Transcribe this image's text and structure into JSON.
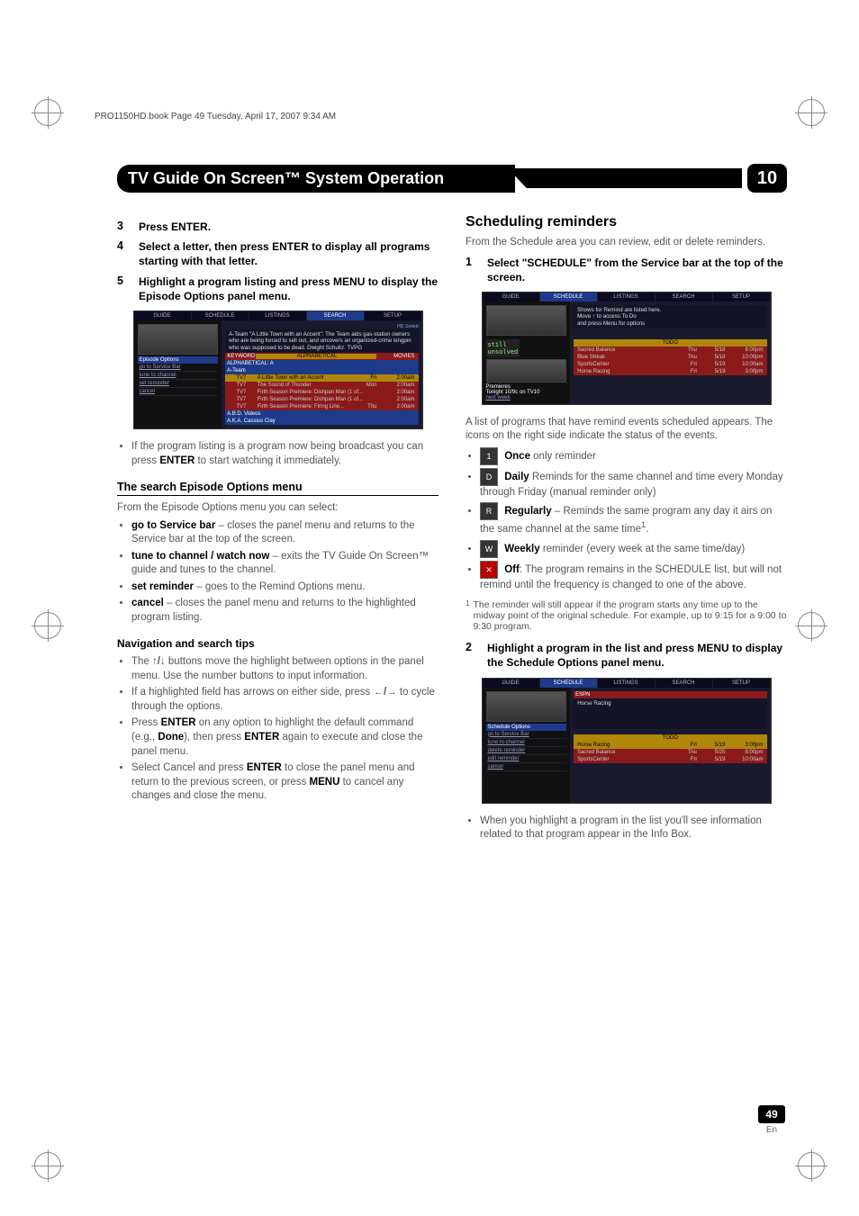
{
  "header_info": "PRO1150HD.book  Page 49  Tuesday, April 17, 2007  9:34 AM",
  "title": "TV Guide On Screen™ System Operation",
  "chapter": "10",
  "left": {
    "step3": {
      "num": "3",
      "text": "Press ENTER."
    },
    "step4": {
      "num": "4",
      "text": "Select a letter, then press ENTER to display all programs starting with that letter."
    },
    "step5": {
      "num": "5",
      "text": "Highlight a program listing and press MENU to display the Episode Options panel menu."
    },
    "para_after_ss": "If the program listing is a program now being broadcast you can press ",
    "para_after_ss_bold": "ENTER",
    "para_after_ss_end": " to start watching it immediately.",
    "h3_search": "The search Episode Options menu",
    "search_intro": "From the Episode Options menu you can select:",
    "search_items": [
      {
        "bold": "go to Service bar",
        "rest": " – closes the panel menu and returns to the Service bar at the top of the screen."
      },
      {
        "bold": "tune to channel / watch now",
        "rest": " – exits the TV Guide On Screen™ guide and tunes to the channel."
      },
      {
        "bold": "set reminder",
        "rest": " – goes to the Remind Options menu."
      },
      {
        "bold": "cancel",
        "rest": " – closes the panel menu and returns to the highlighted program listing."
      }
    ],
    "h4_nav": "Navigation and search tips",
    "nav_items": [
      "The ↑/↓ buttons move the highlight between options in the panel menu. Use the number buttons to input information.",
      "If a highlighted field has arrows on either side, press ←/→ to cycle through the options.",
      "Press ENTER on any option to highlight the default command (e.g., Done), then press ENTER again to execute and close the panel menu.",
      "Select Cancel and press ENTER to close the panel menu and return to the previous screen, or press MENU to cancel any changes and close the menu."
    ],
    "nav_item1_a": "The ",
    "nav_item1_b": " buttons move the highlight between options in the panel menu. Use the number buttons to input information.",
    "nav_item2_a": "If a highlighted field has arrows on either side, press ",
    "nav_item2_b": " to cycle through the options.",
    "nav_item3_a": "Press ",
    "nav_item3_b": " on any option to highlight the default command (e.g., ",
    "nav_item3_c": "), then press ",
    "nav_item3_d": " again to execute and close the panel menu.",
    "nav_item4_a": "Select Cancel and press ",
    "nav_item4_b": " to close the panel menu and return to the previous screen, or press ",
    "nav_item4_c": " to cancel any changes and close the menu.",
    "enter": "ENTER",
    "done": "Done",
    "menu": "MENU",
    "updown": "↑/↓",
    "leftright": "←/→"
  },
  "right": {
    "h2": "Scheduling reminders",
    "intro": "From the Schedule area you can review, edit or delete reminders.",
    "step1": {
      "num": "1",
      "text": "Select \"SCHEDULE\" from the Service bar at the top of the screen."
    },
    "after_ss1": "A list of programs that have remind events scheduled appears. The icons on the right side indicate the status of the events.",
    "icons": [
      {
        "bold": "Once",
        "rest": " only reminder"
      },
      {
        "bold": "Daily",
        "rest": " Reminds for the same channel and time every Monday through Friday (manual reminder only)"
      },
      {
        "bold": "Regularly",
        "rest": " – Reminds the same program any day it airs on the same channel at the same time"
      },
      {
        "bold": "Weekly",
        "rest": " reminder (every week at the same time/day)"
      },
      {
        "bold": "Off",
        "rest": ": The program remains in the SCHEDULE list, but will not remind until the frequency is changed to one of the above."
      }
    ],
    "footnote_num": "1",
    "footnote": "The reminder will still appear if the program starts any time up to the midway point of the original schedule. For example, up to 9:15 for a 9:00 to 9:30 program.",
    "step2": {
      "num": "2",
      "text": "Highlight a program in the list and press MENU to display the Schedule Options panel menu."
    },
    "after_ss2": "When you highlight a program in the list you'll see information related to that program appear in the Info Box."
  },
  "page_num": "49",
  "page_lang": "En",
  "ss1": {
    "tabs": [
      "GUIDE",
      "SCHEDULE",
      "LISTINGS",
      "SEARCH",
      "SETUP"
    ],
    "active_tab": 3,
    "sort_label": "HD Sorted",
    "info": "A-Team \"A Little Town with an Accent\": The Team aids gas-station owners who are being forced to sell out, and uncovers an organized-crime kingpin who was supposed to be dead. Dwight Schultz. TVPG",
    "left_title": "Episode Options",
    "left_items": [
      "go to Service Bar",
      "tune to channel",
      "set reminder",
      "cancel"
    ],
    "cat_row": [
      "KEYWORD",
      "ALPHABETICAL",
      "MOVIES"
    ],
    "group": "ALPHABETICAL: A",
    "series": "A-Team",
    "rows": [
      {
        "ch": "TV7",
        "title": "A Little Town with an Accent",
        "day": "Fri",
        "time": "2:00am"
      },
      {
        "ch": "TV7",
        "title": "The Sound of Thunder",
        "day": "Mon",
        "time": "2:00am"
      },
      {
        "ch": "TV7",
        "title": "Firth Season Premiere: Dishpan Man (1 of...",
        "day": "",
        "time": "2:00am"
      },
      {
        "ch": "TV7",
        "title": "Firth Season Premiere: Dishpan Man (1 of...",
        "day": "",
        "time": "2:00am"
      },
      {
        "ch": "TV7",
        "title": "Firth Season Premiere: Firing Line...",
        "day": "Thu",
        "time": "2:00am"
      }
    ],
    "footer1": "A.B.D. Videos",
    "footer2": "A.K.A. Cassius Clay"
  },
  "ss2": {
    "tabs": [
      "GUIDE",
      "SCHEDULE",
      "LISTINGS",
      "SEARCH",
      "SETUP"
    ],
    "active_tab": 1,
    "info_l1": "Shows for Remind are listed here.",
    "info_l2": "Move ↑ to access To Do",
    "info_l3": "and press Menu for options",
    "left_badge_a": "still",
    "left_badge_b": "unsolved",
    "left_promo_a": "Premieres",
    "left_promo_b": "Tonight 10/9c on TV10",
    "left_promo_c": "next week",
    "header": "TODO",
    "rows": [
      {
        "title": "Sacred Balance",
        "day": "Thu",
        "date": "5/18",
        "time": "8:00pm"
      },
      {
        "title": "Blue Streak",
        "day": "Thu",
        "date": "5/18",
        "time": "10:00pm"
      },
      {
        "title": "SportsCenter",
        "day": "Fri",
        "date": "5/19",
        "time": "10:00am"
      },
      {
        "title": "Horse Racing",
        "day": "Fri",
        "date": "5/19",
        "time": "3:00pm"
      }
    ]
  },
  "ss3": {
    "tabs": [
      "GUIDE",
      "SCHEDULE",
      "LISTINGS",
      "SEARCH",
      "SETUP"
    ],
    "active_tab": 1,
    "top_label": "ESPN",
    "info": "Horse Racing",
    "left_title": "Schedule Options",
    "left_items": [
      "go to Service Bar",
      "tune to channel",
      "delete reminder",
      "edit reminder",
      "cancel"
    ],
    "header": "TODO",
    "rows": [
      {
        "title": "Horse Racing",
        "day": "Fri",
        "date": "5/19",
        "time": "3:00pm"
      },
      {
        "title": "Sacred Balance",
        "day": "Thu",
        "date": "5/25",
        "time": "8:00pm"
      },
      {
        "title": "SportsCenter",
        "day": "Fri",
        "date": "5/19",
        "time": "10:00am"
      }
    ]
  }
}
